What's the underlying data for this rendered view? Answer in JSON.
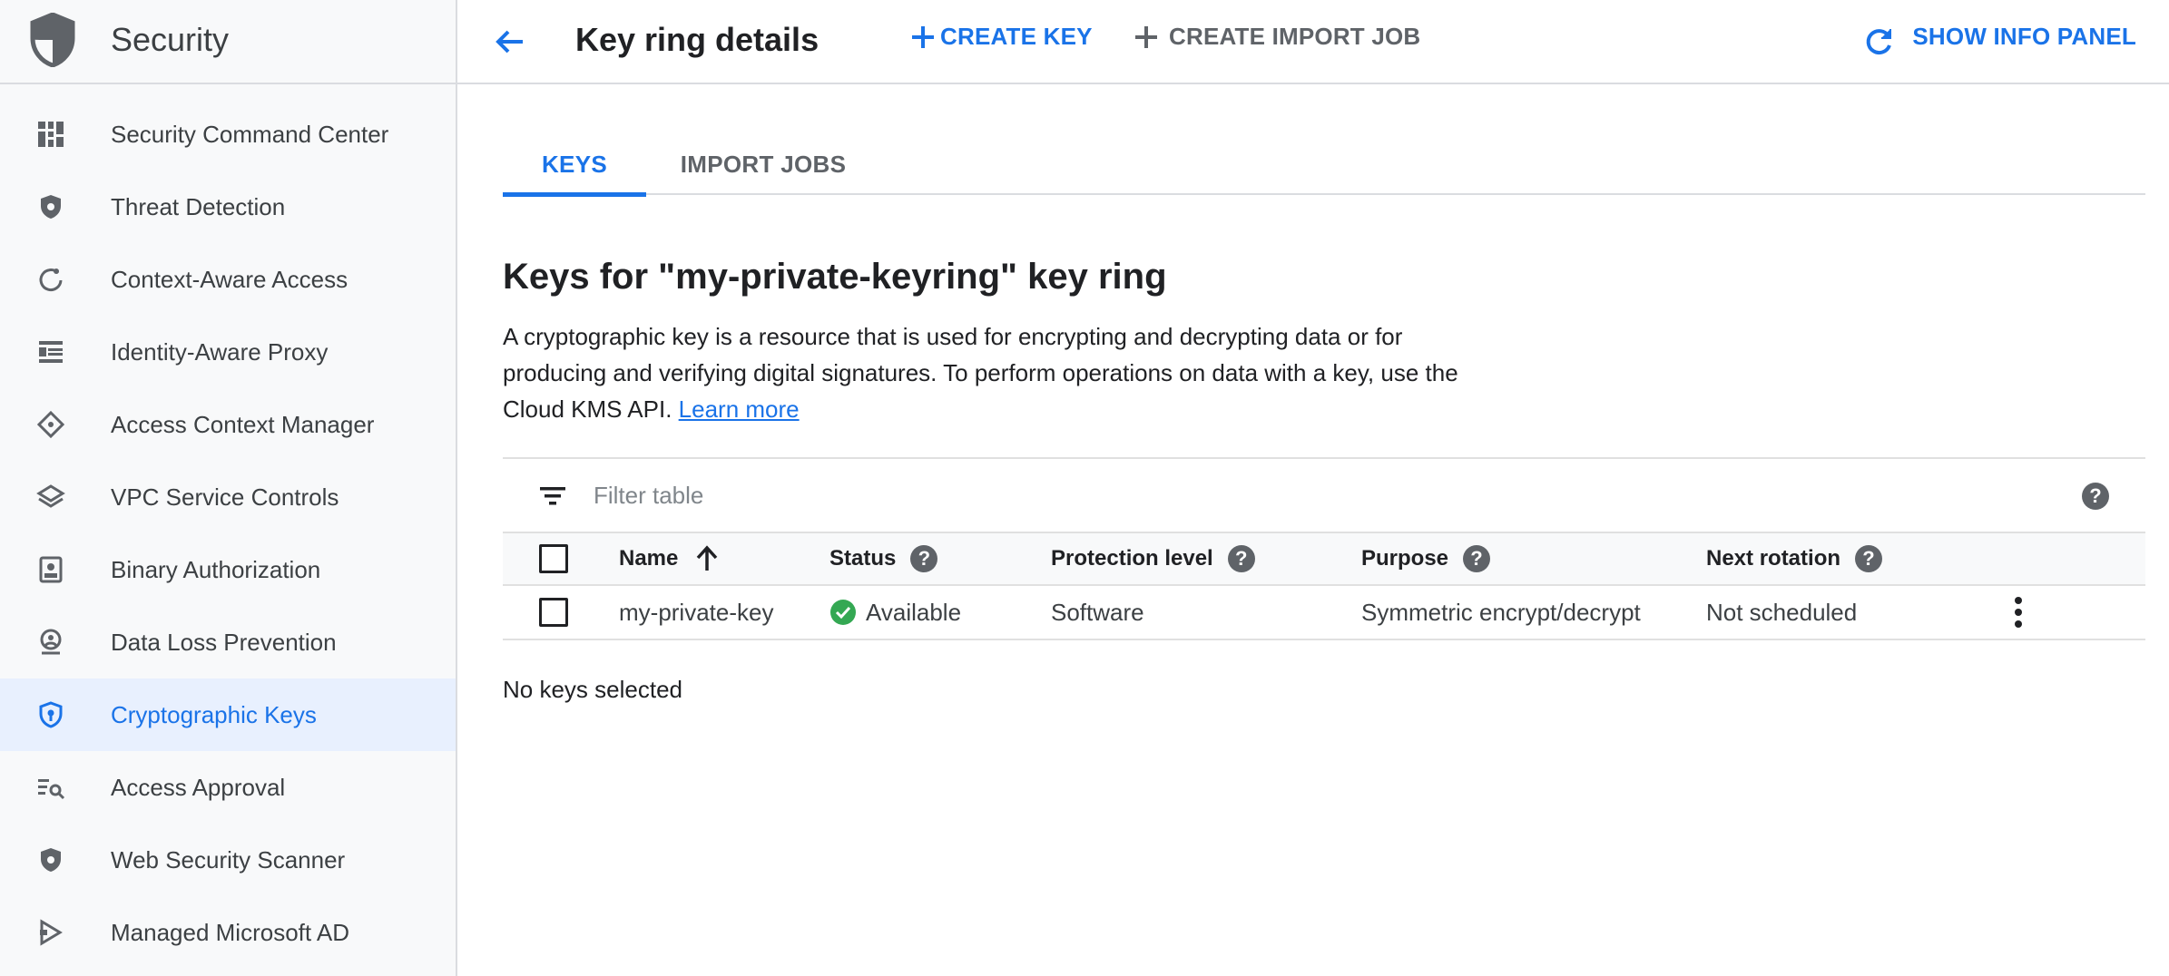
{
  "colors": {
    "accent": "#1a73e8",
    "sidebar_bg": "#f8f9fa",
    "active_bg": "#e8f0fe",
    "status_green": "#34a853"
  },
  "sidebar": {
    "title": "Security",
    "logo_icon": "shield-icon",
    "items": [
      {
        "label": "Security Command Center",
        "icon": "dashboard-icon"
      },
      {
        "label": "Threat Detection",
        "icon": "shield-icon"
      },
      {
        "label": "Context-Aware Access",
        "icon": "circle-refresh-icon"
      },
      {
        "label": "Identity-Aware Proxy",
        "icon": "proxy-icon"
      },
      {
        "label": "Access Context Manager",
        "icon": "diamond-icon"
      },
      {
        "label": "VPC Service Controls",
        "icon": "layers-icon"
      },
      {
        "label": "Binary Authorization",
        "icon": "badge-icon"
      },
      {
        "label": "Data Loss Prevention",
        "icon": "person-lock-icon"
      },
      {
        "label": "Cryptographic Keys",
        "icon": "key-shield-icon",
        "active": true
      },
      {
        "label": "Access Approval",
        "icon": "list-search-icon"
      },
      {
        "label": "Web Security Scanner",
        "icon": "shield-icon"
      },
      {
        "label": "Managed Microsoft AD",
        "icon": "ad-icon"
      }
    ]
  },
  "header": {
    "title": "Key ring details",
    "create_key": "CREATE KEY",
    "create_import_job": "CREATE IMPORT JOB",
    "show_info_panel": "SHOW INFO PANEL"
  },
  "tabs": [
    {
      "label": "KEYS",
      "active": true
    },
    {
      "label": "IMPORT JOBS",
      "active": false
    }
  ],
  "content": {
    "section_title": "Keys for \"my-private-keyring\" key ring",
    "description": "A cryptographic key is a resource that is used for encrypting and decrypting data or for producing and verifying digital signatures. To perform operations on data with a key, use the Cloud KMS API.",
    "learn_more": "Learn more",
    "filter_placeholder": "Filter table",
    "selection_text": "No keys selected"
  },
  "table": {
    "columns": [
      "Name",
      "Status",
      "Protection level",
      "Purpose",
      "Next rotation"
    ],
    "help_glyph": "?",
    "rows": [
      {
        "name": "my-private-key",
        "status": "Available",
        "protection_level": "Software",
        "purpose": "Symmetric encrypt/decrypt",
        "next_rotation": "Not scheduled"
      }
    ]
  }
}
